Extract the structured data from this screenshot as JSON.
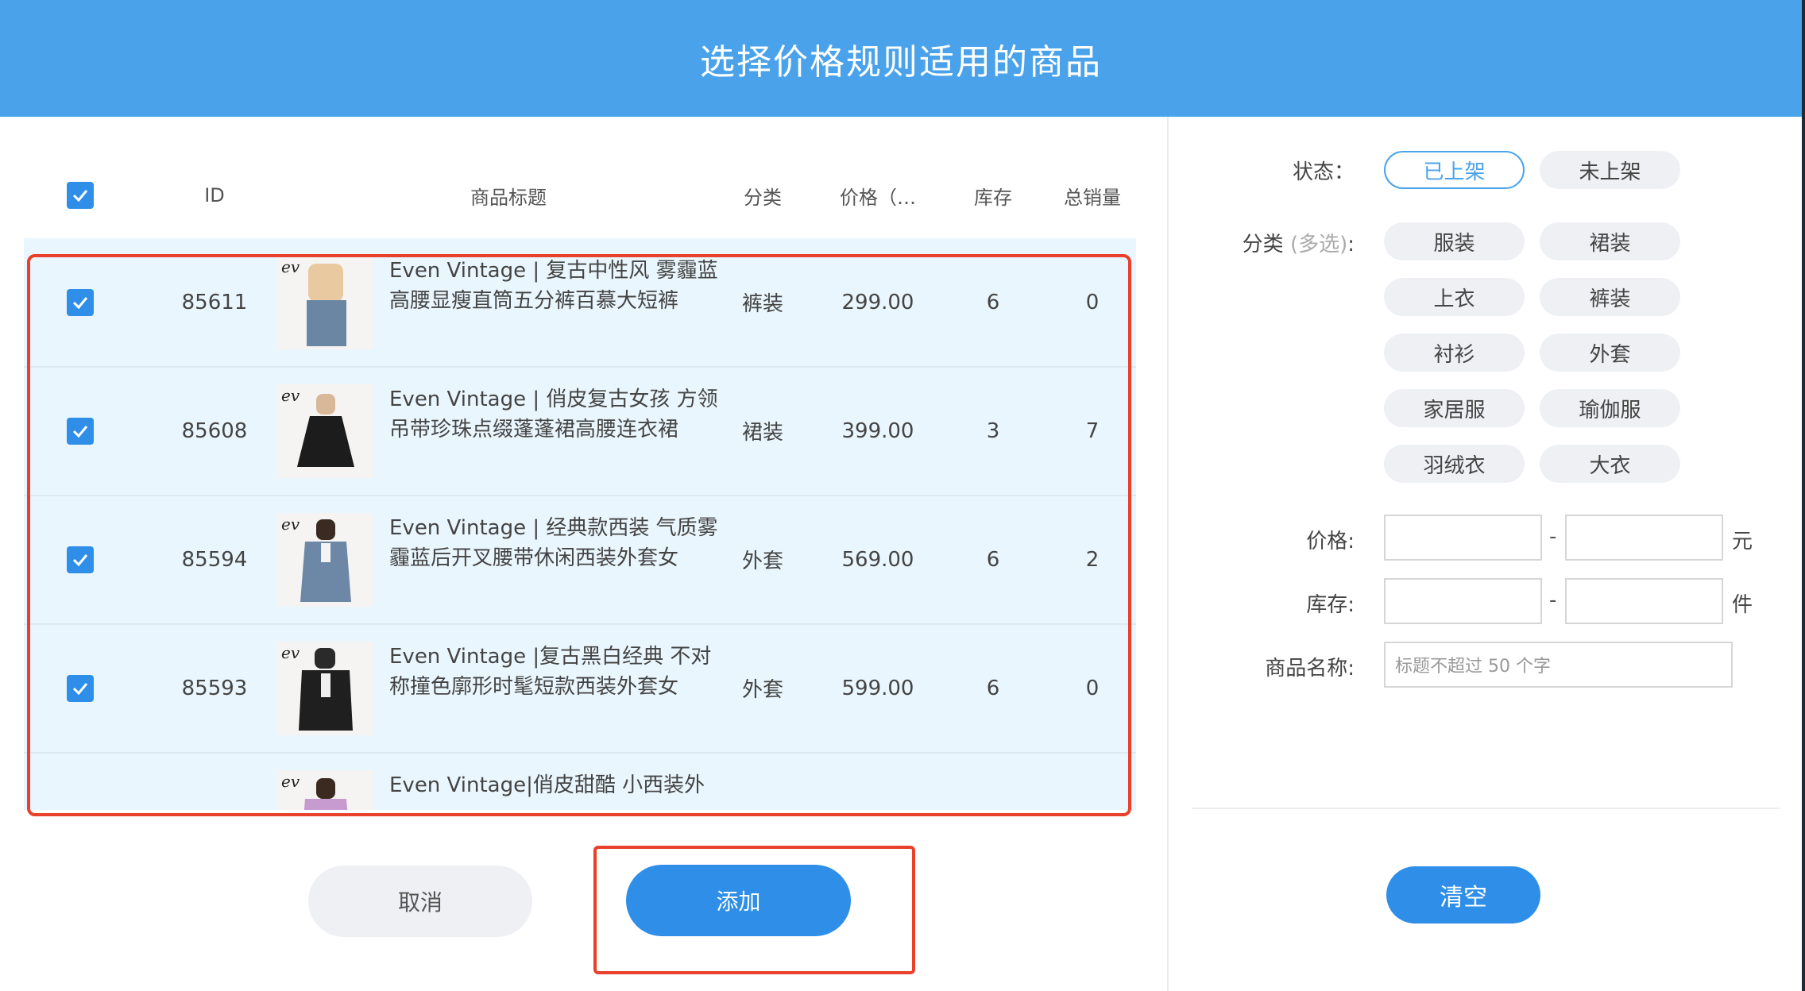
{
  "header": {
    "title": "选择价格规则适用的商品"
  },
  "table": {
    "headers": {
      "id": "ID",
      "title": "商品标题",
      "category": "分类",
      "price": "价格（…",
      "stock": "库存",
      "sales": "总销量"
    },
    "rows": [
      {
        "id": "85611",
        "logo": "ev",
        "title": "Even Vintage | 复古中性风 雾霾蓝高腰显瘦直筒五分裤百慕大短裤",
        "category": "裤装",
        "price": "299.00",
        "stock": "6",
        "sales": "0"
      },
      {
        "id": "85608",
        "logo": "ev",
        "title": "Even Vintage | 俏皮复古女孩 方领吊带珍珠点缀蓬蓬裙高腰连衣裙",
        "category": "裙装",
        "price": "399.00",
        "stock": "3",
        "sales": "7"
      },
      {
        "id": "85594",
        "logo": "ev",
        "title": "Even Vintage | 经典款西装 气质雾霾蓝后开叉腰带休闲西装外套女",
        "category": "外套",
        "price": "569.00",
        "stock": "6",
        "sales": "2"
      },
      {
        "id": "85593",
        "logo": "ev",
        "title": "Even Vintage |复古黑白经典 不对称撞色廓形时髦短款西装外套女",
        "category": "外套",
        "price": "599.00",
        "stock": "6",
        "sales": "0"
      },
      {
        "id": "",
        "logo": "ev",
        "title": "Even Vintage|俏皮甜酷 小西装外",
        "category": "",
        "price": "",
        "stock": "",
        "sales": ""
      }
    ]
  },
  "buttons": {
    "cancel": "取消",
    "add": "添加",
    "clear": "清空"
  },
  "filters": {
    "status_label": "状态：",
    "status_options": [
      "已上架",
      "未上架"
    ],
    "status_selected": "已上架",
    "category_label": "分类",
    "category_hint": "(多选)",
    "category_colon": ":",
    "categories": [
      "服装",
      "裙装",
      "上衣",
      "裤装",
      "衬衫",
      "外套",
      "家居服",
      "瑜伽服",
      "羽绒衣",
      "大衣"
    ],
    "price_label": "价格:",
    "price_unit": "元",
    "stock_label": "库存:",
    "stock_unit": "件",
    "range_sep": "-",
    "name_label": "商品名称:",
    "name_placeholder": "标题不超过 50 个字"
  },
  "colors": {
    "header": "#4aa3ea",
    "accent": "#2e8ee8",
    "highlight": "#e8402a",
    "row_bg": "#eaf6fd"
  }
}
